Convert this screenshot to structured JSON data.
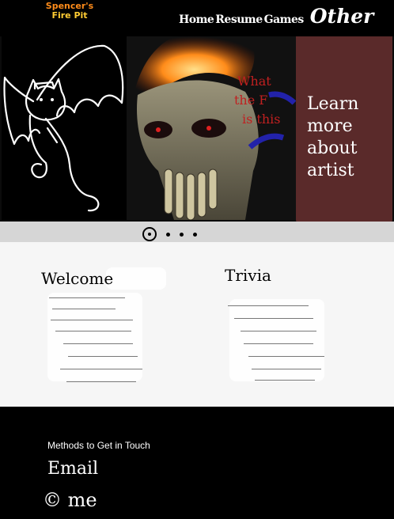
{
  "header": {
    "logo_line1": "Spencer's",
    "logo_line2": "Fire Pit",
    "nav_items": [
      "Home",
      "Resume",
      "Games",
      "Other"
    ]
  },
  "hero": {
    "art_text": [
      "What",
      "the F",
      "is this"
    ],
    "learn_more": "Learn more about artist",
    "colors": {
      "learn_panel": "#5a2a2a",
      "flame": "#ff6a00"
    }
  },
  "carousel": {
    "slide_count": 4,
    "active_index": 1
  },
  "content": {
    "welcome_title": "Welcome",
    "trivia_title": "Trivia"
  },
  "footer": {
    "heading": "Methods to Get in Touch",
    "email": "Email",
    "copyright": "© me"
  }
}
